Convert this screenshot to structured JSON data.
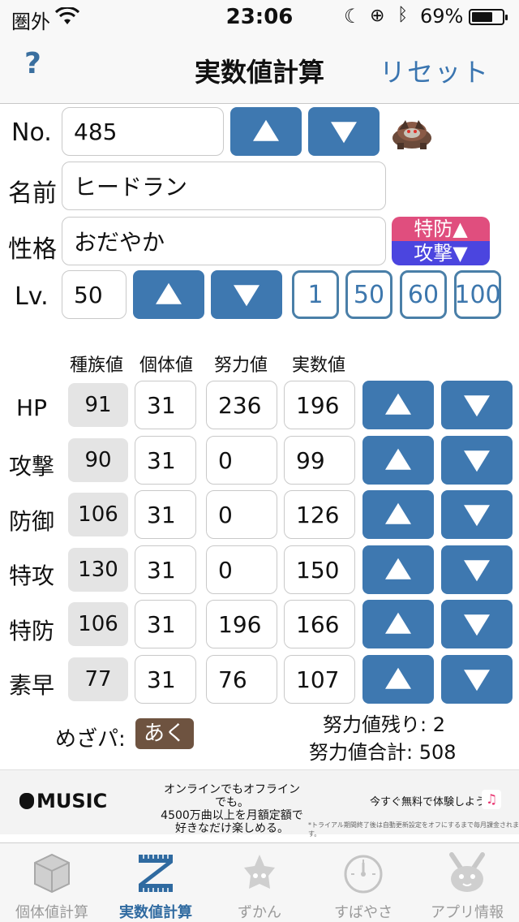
{
  "status_bar": {
    "carrier": "圏外",
    "time": "23:06",
    "battery_pct": "69%",
    "battery_level": 0.69
  },
  "nav": {
    "help": "?",
    "title": "実数値計算",
    "reset": "リセット"
  },
  "form": {
    "no_label": "No.",
    "no_value": "485",
    "name_label": "名前",
    "name_value": "ヒードラン",
    "nature_label": "性格",
    "nature_value": "おだやか",
    "nature_up": "特防▲",
    "nature_down": "攻撃▼",
    "lv_label": "Lv.",
    "lv_value": "50",
    "lv_quick": [
      "1",
      "50",
      "60",
      "100"
    ]
  },
  "columns": {
    "base": "種族値",
    "iv": "個体値",
    "ev": "努力値",
    "actual": "実数値"
  },
  "stats": [
    {
      "label": "HP",
      "base": "91",
      "iv": "31",
      "ev": "236",
      "actual": "196"
    },
    {
      "label": "攻撃",
      "base": "90",
      "iv": "31",
      "ev": "0",
      "actual": "99"
    },
    {
      "label": "防御",
      "base": "106",
      "iv": "31",
      "ev": "0",
      "actual": "126"
    },
    {
      "label": "特攻",
      "base": "130",
      "iv": "31",
      "ev": "0",
      "actual": "150"
    },
    {
      "label": "特防",
      "base": "106",
      "iv": "31",
      "ev": "196",
      "actual": "166"
    },
    {
      "label": "素早",
      "base": "77",
      "iv": "31",
      "ev": "76",
      "actual": "107"
    }
  ],
  "mezapa": {
    "label": "めざパ:",
    "type": "あく",
    "type_color": "#6e5340"
  },
  "ev_summary": {
    "remaining": "努力値残り: 2",
    "total": "努力値合計: 508"
  },
  "ad": {
    "brand": "MUSIC",
    "copy_1": "オンラインでもオフラインでも。",
    "copy_2": "4500万曲以上を月額定額で",
    "copy_3": "好きなだけ楽しめる。",
    "cta": "今すぐ無料で体験しよう",
    "fine_print": "*トライアル期間終了後は自動更新設定をオフにするまで毎月課金されます。"
  },
  "tabs": [
    {
      "label": "個体値計算",
      "icon": "cube-icon",
      "active": false
    },
    {
      "label": "実数値計算",
      "icon": "ruler-z-icon",
      "active": true
    },
    {
      "label": "ずかん",
      "icon": "pokedex-icon",
      "active": false
    },
    {
      "label": "すばやさ",
      "icon": "speedometer-icon",
      "active": false
    },
    {
      "label": "アプリ情報",
      "icon": "pikachu-icon",
      "active": false
    }
  ],
  "colors": {
    "accent": "#3e78b0",
    "nature_up": "#e04e7e",
    "nature_down": "#4b45df",
    "tab_active": "#2f6aa0"
  }
}
